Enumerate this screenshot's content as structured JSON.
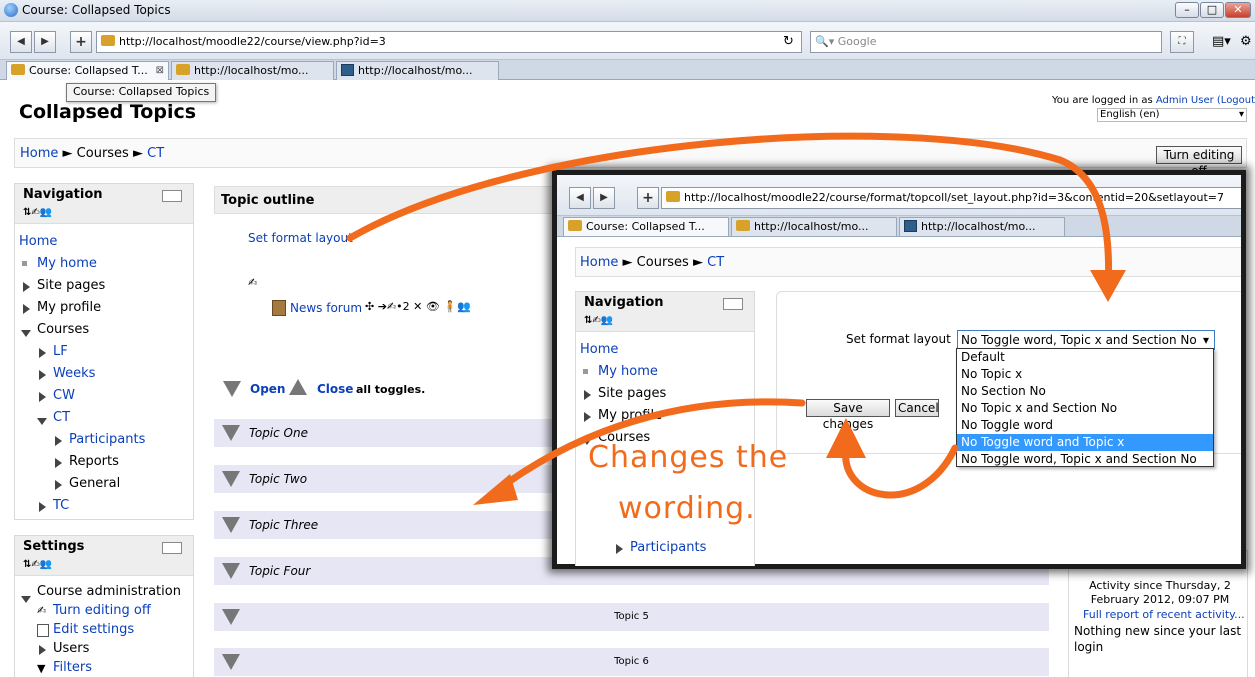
{
  "window": {
    "title": "Course: Collapsed Topics",
    "min": "–",
    "max": "□",
    "close": "✕"
  },
  "browser": {
    "url": "http://localhost/moodle22/course/view.php?id=3",
    "search_placeholder": "Google",
    "tabs": [
      {
        "label": "Course: Collapsed T..."
      },
      {
        "label": "http://localhost/mo..."
      },
      {
        "label": "http://localhost/mo..."
      }
    ],
    "tooltip": "Course: Collapsed Topics"
  },
  "header": {
    "page_title": "Collapsed Topics",
    "logged_in_prefix": "You are logged in as",
    "user": "Admin User",
    "logout": "(Logout)",
    "language": "English (en)"
  },
  "breadcrumb": {
    "home": "Home",
    "courses": "Courses",
    "current": "CT",
    "sep": "►"
  },
  "turn_editing_off_button": "Turn editing off",
  "navigation": {
    "title": "Navigation",
    "home": "Home",
    "my_home": "My home",
    "site_pages": "Site pages",
    "my_profile": "My profile",
    "courses": "Courses",
    "course_list": [
      "LF",
      "Weeks",
      "CW",
      "CT"
    ],
    "ct_children": [
      "Participants",
      "Reports",
      "General"
    ],
    "tc": "TC"
  },
  "settings": {
    "title": "Settings",
    "course_admin": "Course administration",
    "turn_editing_off": "Turn editing off",
    "edit_settings": "Edit settings",
    "users": "Users",
    "filters": "Filters"
  },
  "main": {
    "topic_outline": "Topic outline",
    "set_format_layout": "Set format layout",
    "news_forum": "News forum",
    "open": "Open",
    "close": "Close",
    "all_toggles": "all toggles.",
    "topics": [
      "Topic One",
      "Topic Two",
      "Topic Three",
      "Topic Four"
    ],
    "topics_centered": [
      "Topic 5",
      "Topic 6"
    ]
  },
  "recent": {
    "activity_since": "Activity since Thursday, 2 February 2012, 09:07 PM",
    "full_report": "Full report of recent activity...",
    "nothing_new": "Nothing new since your last login"
  },
  "overlay": {
    "url": "http://localhost/moodle22/course/format/topcoll/set_layout.php?id=3&contentid=20&setlayout=7",
    "tabs": [
      {
        "label": "Course: Collapsed T..."
      },
      {
        "label": "http://localhost/mo..."
      },
      {
        "label": "http://localhost/mo..."
      }
    ],
    "breadcrumb": {
      "home": "Home",
      "courses": "Courses",
      "current": "CT"
    },
    "nav_title": "Navigation",
    "nav_items": {
      "home": "Home",
      "my_home": "My home",
      "site_pages": "Site pages",
      "my_profile": "My profile",
      "courses": "Courses",
      "participants": "Participants"
    },
    "form_label": "Set format layout",
    "selected": "No Toggle word, Topic x and Section No",
    "options": [
      "Default",
      "No Topic x",
      "No Section No",
      "No Topic x and Section No",
      "No Toggle word",
      "No Toggle word and Topic x",
      "No Toggle word, Topic x and Section No"
    ],
    "highlighted_index": 5,
    "save": "Save changes",
    "cancel": "Cancel"
  },
  "annotation": {
    "line1": "Changes the",
    "line2": "wording."
  },
  "colors": {
    "link": "#0a3fb8",
    "annotation": "#f26b1d",
    "topic_band": "#e6e6f5",
    "highlight": "#3399ff"
  }
}
